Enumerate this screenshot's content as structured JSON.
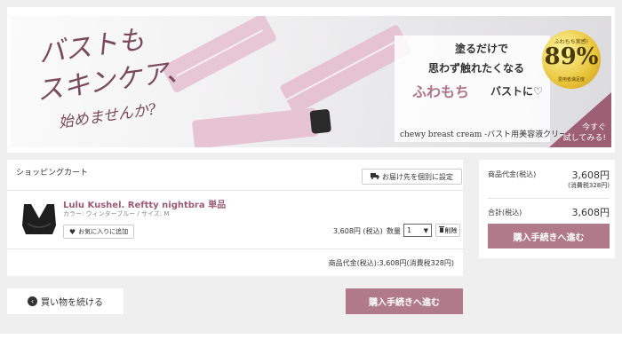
{
  "banner": {
    "headline": [
      "バストも",
      "スキンケア、",
      "始めませんか?"
    ],
    "copy_line1": "塗るだけで",
    "copy_line2": "思わず触れたくなる",
    "copy_highlight": "ふわもち",
    "copy_line3_rest": "バストに♡",
    "product_name": "chewy breast cream -バスト用美容液クリーム-",
    "medal_top": "ふわもち実感!",
    "medal_number": "89%",
    "medal_bottom": "愛用者満足度",
    "corner_text": "今すぐ\n試してみる!"
  },
  "cart": {
    "title": "ショッピングカート",
    "ship_button": "お届け先を個別に設定",
    "item": {
      "name": "Lulu Kushel. Reftty nightbra 単品",
      "options": "カラー: ウィンターブルー / サイズ: M",
      "favorite_button": "お気に入りに追加",
      "price": "3,608円 (税込)",
      "qty_label": "数量",
      "qty_value": "1",
      "delete_button": "削除"
    },
    "subtotal": "商品代金(税込):3,608円(消費税328円)"
  },
  "summary": {
    "product_label": "商品代金(税込)",
    "product_value": "3,608円",
    "tax_note": "(消費税328円)",
    "total_label": "合計(税込)",
    "total_value": "3,608円",
    "checkout_button": "購入手続きへ進む"
  },
  "actions": {
    "continue_button": "買い物を続ける",
    "checkout_button": "購入手続きへ進む"
  },
  "colors": {
    "accent": "#b17a8b",
    "item_name": "#9c5a74",
    "background": "#efefef"
  }
}
